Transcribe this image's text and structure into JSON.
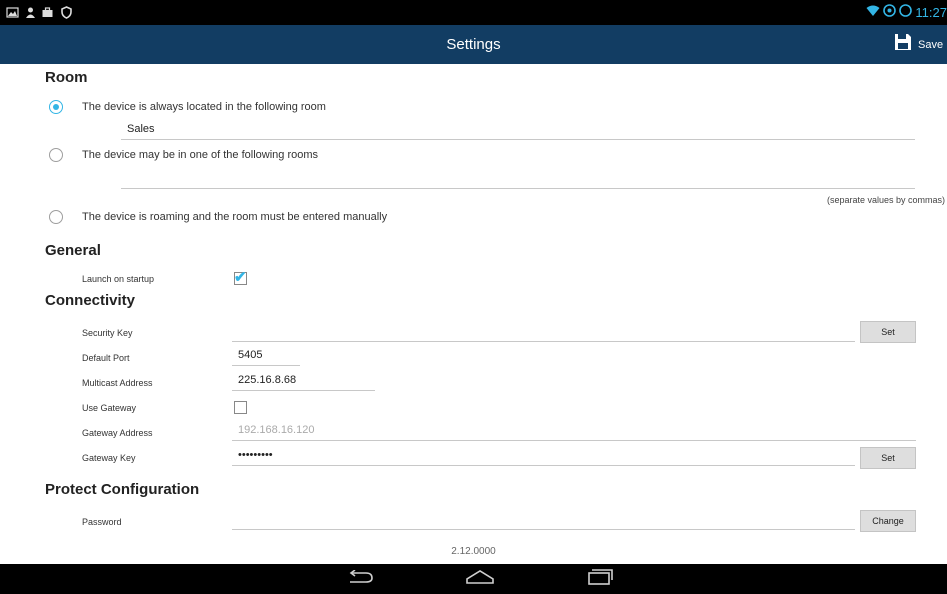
{
  "status_bar": {
    "left_icons": [
      "gallery-icon",
      "person-icon",
      "suitcase-icon",
      "shield-icon"
    ],
    "right_icons": [
      "wifi-icon",
      "data-icon",
      "battery-icon"
    ],
    "time": "11:27",
    "accent_color": "#33b5e5"
  },
  "action_bar": {
    "title": "Settings",
    "save_label": "Save",
    "background": "#123d63"
  },
  "room": {
    "title": "Room",
    "options": [
      {
        "label": "The device is always located in the following room",
        "selected": true
      },
      {
        "label": "The device may be in one of the following rooms",
        "selected": false
      },
      {
        "label": "The device is roaming and the room must be entered manually",
        "selected": false
      }
    ],
    "fixed_room_value": "Sales",
    "rooms_list_value": "",
    "rooms_hint": "(separate values by commas)"
  },
  "general": {
    "title": "General",
    "launch_on_startup_label": "Launch on startup",
    "launch_on_startup_checked": true
  },
  "connectivity": {
    "title": "Connectivity",
    "security_key_label": "Security Key",
    "security_key_value": "",
    "set_label": "Set",
    "default_port_label": "Default Port",
    "default_port_value": "5405",
    "multicast_label": "Multicast Address",
    "multicast_value": "225.16.8.68",
    "use_gateway_label": "Use Gateway",
    "use_gateway_checked": false,
    "gateway_address_label": "Gateway Address",
    "gateway_address_value": "192.168.16.120",
    "gateway_key_label": "Gateway Key",
    "gateway_key_value": "•••••••••",
    "gateway_set_label": "Set"
  },
  "protect": {
    "title": "Protect Configuration",
    "password_label": "Password",
    "password_value": "",
    "change_label": "Change"
  },
  "version": "2.12.0000",
  "nav_bar": [
    "back-icon",
    "home-icon",
    "recent-apps-icon"
  ]
}
